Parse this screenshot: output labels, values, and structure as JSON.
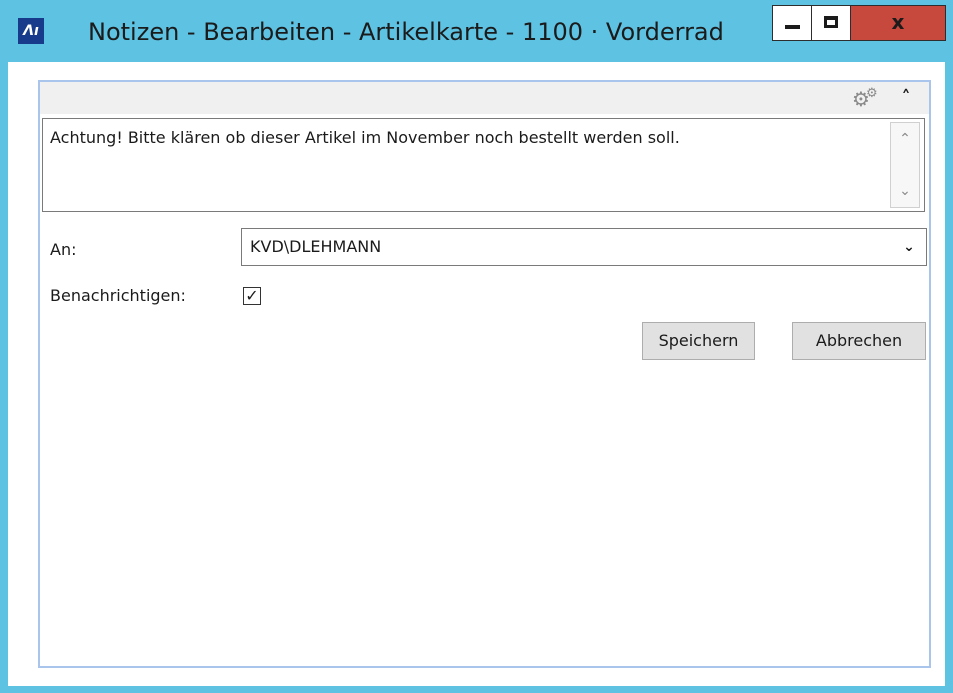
{
  "window": {
    "title": "Notizen - Bearbeiten - Artikelkarte - 1100 · Vorderrad",
    "app_icon_text": "Ʌı",
    "controls": {
      "minimize_icon": "minimize-icon",
      "maximize_icon": "maximize-icon",
      "close_label": "x"
    }
  },
  "panel": {
    "header_icons": [
      "settings-icon",
      "collapse-icon"
    ],
    "note_text": "Achtung! Bitte klären ob dieser Artikel im November noch bestellt werden soll."
  },
  "form": {
    "to_label": "An:",
    "to_value": "KVD\\DLEHMANN",
    "notify_label": "Benachrichtigen:",
    "notify_checked": true
  },
  "buttons": {
    "save_label": "Speichern",
    "cancel_label": "Abbrechen"
  },
  "colors": {
    "title_bar": "#5ec3e3",
    "close_button": "#c7483d",
    "panel_border": "#a9c5ec"
  }
}
